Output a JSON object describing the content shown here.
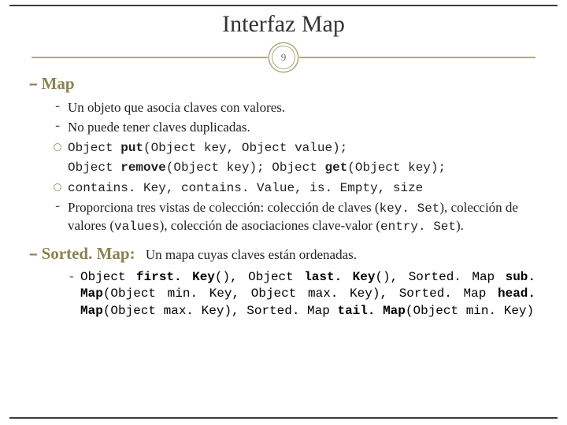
{
  "title": "Interfaz Map",
  "page_number": "9",
  "section_map": {
    "heading": "Map",
    "items": [
      {
        "bullet": "dash",
        "text": "Un objeto que asocia claves con valores."
      },
      {
        "bullet": "dash",
        "text": "No puede tener claves duplicadas."
      },
      {
        "bullet": "circ",
        "code_prefix": "Object ",
        "code_bold": "put",
        "code_suffix": "(Object key, Object value);"
      },
      {
        "bullet": "none",
        "code_prefix1": "Object ",
        "code_bold1": "remove",
        "code_mid1": "(Object key); Object ",
        "code_bold2": "get",
        "code_suffix2": "(Object key);"
      },
      {
        "bullet": "circ",
        "code_plain": "contains. Key, contains. Value, is. Empty, size"
      },
      {
        "bullet": "dash",
        "mixed_pre": "Proporciona tres vistas de colección: colección de claves (",
        "mixed_c1": "key. Set",
        "mixed_mid1": "), colección de valores (",
        "mixed_c2": "values",
        "mixed_mid2": "), colección de asociaciones clave-valor (",
        "mixed_c3": "entry. Set",
        "mixed_post": ")."
      }
    ]
  },
  "section_sortedmap": {
    "heading": "Sorted. Map:",
    "inline_desc": "Un mapa cuyas claves están ordenadas.",
    "signatures": {
      "p1a": "Object ",
      "b1": "first. Key",
      "p1b": "(), Object ",
      "b2": "last. Key",
      "p2b": "(), Sorted. Map ",
      "b3": "sub. Map",
      "p3b": "(Object min. Key, Object max. Key), Sorted. Map ",
      "b4": "head. Map",
      "p4b": "(Object max. Key), Sorted. Map ",
      "b5": "tail. Map",
      "p5b": "(Object min. Key)"
    }
  }
}
